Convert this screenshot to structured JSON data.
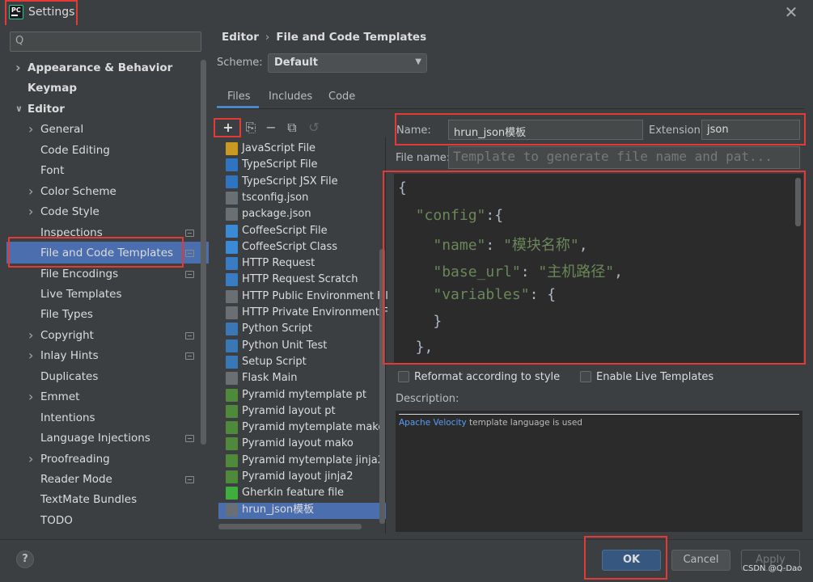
{
  "window": {
    "title": "Settings",
    "close": "✕",
    "logo_text": "PC"
  },
  "search": {
    "placeholder": "",
    "glyph": "Q"
  },
  "sidebar": {
    "items": [
      {
        "label": "Appearance & Behavior",
        "level": 0,
        "bold": true,
        "arrow": "right",
        "gear": false
      },
      {
        "label": "Keymap",
        "level": 0,
        "bold": true,
        "arrow": null,
        "gear": false
      },
      {
        "label": "Editor",
        "level": 0,
        "bold": true,
        "arrow": "down",
        "gear": false
      },
      {
        "label": "General",
        "level": 1,
        "bold": false,
        "arrow": "right",
        "gear": false
      },
      {
        "label": "Code Editing",
        "level": 1,
        "bold": false,
        "arrow": null,
        "gear": false
      },
      {
        "label": "Font",
        "level": 1,
        "bold": false,
        "arrow": null,
        "gear": false
      },
      {
        "label": "Color Scheme",
        "level": 1,
        "bold": false,
        "arrow": "right",
        "gear": false
      },
      {
        "label": "Code Style",
        "level": 1,
        "bold": false,
        "arrow": "right",
        "gear": false
      },
      {
        "label": "Inspections",
        "level": 1,
        "bold": false,
        "arrow": null,
        "gear": true
      },
      {
        "label": "File and Code Templates",
        "level": 1,
        "bold": false,
        "arrow": null,
        "gear": true,
        "selected": true
      },
      {
        "label": "File Encodings",
        "level": 1,
        "bold": false,
        "arrow": null,
        "gear": true
      },
      {
        "label": "Live Templates",
        "level": 1,
        "bold": false,
        "arrow": null,
        "gear": false
      },
      {
        "label": "File Types",
        "level": 1,
        "bold": false,
        "arrow": null,
        "gear": false
      },
      {
        "label": "Copyright",
        "level": 1,
        "bold": false,
        "arrow": "right",
        "gear": true
      },
      {
        "label": "Inlay Hints",
        "level": 1,
        "bold": false,
        "arrow": "right",
        "gear": true
      },
      {
        "label": "Duplicates",
        "level": 1,
        "bold": false,
        "arrow": null,
        "gear": false
      },
      {
        "label": "Emmet",
        "level": 1,
        "bold": false,
        "arrow": "right",
        "gear": false
      },
      {
        "label": "Intentions",
        "level": 1,
        "bold": false,
        "arrow": null,
        "gear": false
      },
      {
        "label": "Language Injections",
        "level": 1,
        "bold": false,
        "arrow": null,
        "gear": true
      },
      {
        "label": "Proofreading",
        "level": 1,
        "bold": false,
        "arrow": "right",
        "gear": false
      },
      {
        "label": "Reader Mode",
        "level": 1,
        "bold": false,
        "arrow": null,
        "gear": true
      },
      {
        "label": "TextMate Bundles",
        "level": 1,
        "bold": false,
        "arrow": null,
        "gear": false
      },
      {
        "label": "TODO",
        "level": 1,
        "bold": false,
        "arrow": null,
        "gear": false
      }
    ]
  },
  "breadcrumb": {
    "parent": "Editor",
    "separator": "›",
    "current": "File and Code Templates"
  },
  "scheme": {
    "label": "Scheme:",
    "value": "Default"
  },
  "tabs": [
    {
      "label": "Files",
      "active": true
    },
    {
      "label": "Includes"
    },
    {
      "label": "Code"
    }
  ],
  "toolbar": {
    "add": "+",
    "copy": "⎘",
    "remove": "−",
    "duplicate": "⧉",
    "reset": "↺"
  },
  "templates": [
    {
      "label": "JavaScript File",
      "icon_color": "#c99a22"
    },
    {
      "label": "TypeScript File",
      "icon_color": "#2f74c0"
    },
    {
      "label": "TypeScript JSX File",
      "icon_color": "#2f74c0"
    },
    {
      "label": "tsconfig.json",
      "icon_color": "#6a6f73"
    },
    {
      "label": "package.json",
      "icon_color": "#6a6f73"
    },
    {
      "label": "CoffeeScript File",
      "icon_color": "#3a8ad6"
    },
    {
      "label": "CoffeeScript Class",
      "icon_color": "#3a8ad6"
    },
    {
      "label": "HTTP Request",
      "icon_color": "#3a7cc4"
    },
    {
      "label": "HTTP Request Scratch",
      "icon_color": "#3a7cc4"
    },
    {
      "label": "HTTP Public Environment File",
      "icon_color": "#6a6f73"
    },
    {
      "label": "HTTP Private Environment File",
      "icon_color": "#6a6f73"
    },
    {
      "label": "Python Script",
      "icon_color": "#3a78b5"
    },
    {
      "label": "Python Unit Test",
      "icon_color": "#3a78b5"
    },
    {
      "label": "Setup Script",
      "icon_color": "#3a78b5"
    },
    {
      "label": "Flask Main",
      "icon_color": "#6a6f73"
    },
    {
      "label": "Pyramid mytemplate pt",
      "icon_color": "#4f8a3a"
    },
    {
      "label": "Pyramid layout pt",
      "icon_color": "#4f8a3a"
    },
    {
      "label": "Pyramid mytemplate mako",
      "icon_color": "#4f8a3a"
    },
    {
      "label": "Pyramid layout mako",
      "icon_color": "#4f8a3a"
    },
    {
      "label": "Pyramid mytemplate jinja2",
      "icon_color": "#4f8a3a"
    },
    {
      "label": "Pyramid layout jinja2",
      "icon_color": "#4f8a3a"
    },
    {
      "label": "Gherkin feature file",
      "icon_color": "#3fae3f"
    },
    {
      "label": "hrun_json模板",
      "icon_color": "#6a6f73",
      "selected": true
    }
  ],
  "form": {
    "name_label": "Name:",
    "name_value": "hrun_json模板",
    "extension_label": "Extension:",
    "extension_value": "json",
    "filename_label": "File name:",
    "filename_placeholder": "Template to generate file name and pat..."
  },
  "code_lines": [
    [
      {
        "t": "{",
        "c": "p"
      }
    ],
    [
      {
        "t": "  ",
        "c": "p"
      },
      {
        "t": "\"config\"",
        "c": "s"
      },
      {
        "t": ":{",
        "c": "p"
      }
    ],
    [
      {
        "t": "    ",
        "c": "p"
      },
      {
        "t": "\"name\"",
        "c": "s"
      },
      {
        "t": ": ",
        "c": "p"
      },
      {
        "t": "\"模块名称\"",
        "c": "s"
      },
      {
        "t": ",",
        "c": "p"
      }
    ],
    [
      {
        "t": "    ",
        "c": "p"
      },
      {
        "t": "\"base_url\"",
        "c": "s"
      },
      {
        "t": ": ",
        "c": "p"
      },
      {
        "t": "\"主机路径\"",
        "c": "s"
      },
      {
        "t": ",",
        "c": "p"
      }
    ],
    [
      {
        "t": "    ",
        "c": "p"
      },
      {
        "t": "\"variables\"",
        "c": "s"
      },
      {
        "t": ": {",
        "c": "p"
      }
    ],
    [
      {
        "t": "    }",
        "c": "p"
      }
    ],
    [
      {
        "t": "  },",
        "c": "p"
      }
    ]
  ],
  "options": {
    "reformat_label": "Reformat according to style",
    "live_templates_label": "Enable Live Templates"
  },
  "description": {
    "label": "Description:",
    "link": "Apache Velocity",
    "text": " template language is used"
  },
  "footer": {
    "help": "?",
    "ok": "OK",
    "cancel": "Cancel",
    "apply": "Apply"
  },
  "watermark": "CSDN @Q-Dao",
  "colors": {
    "accent": "#4b6eaf",
    "highlight_box": "#e53935",
    "string": "#6a8759",
    "link": "#589df6"
  }
}
